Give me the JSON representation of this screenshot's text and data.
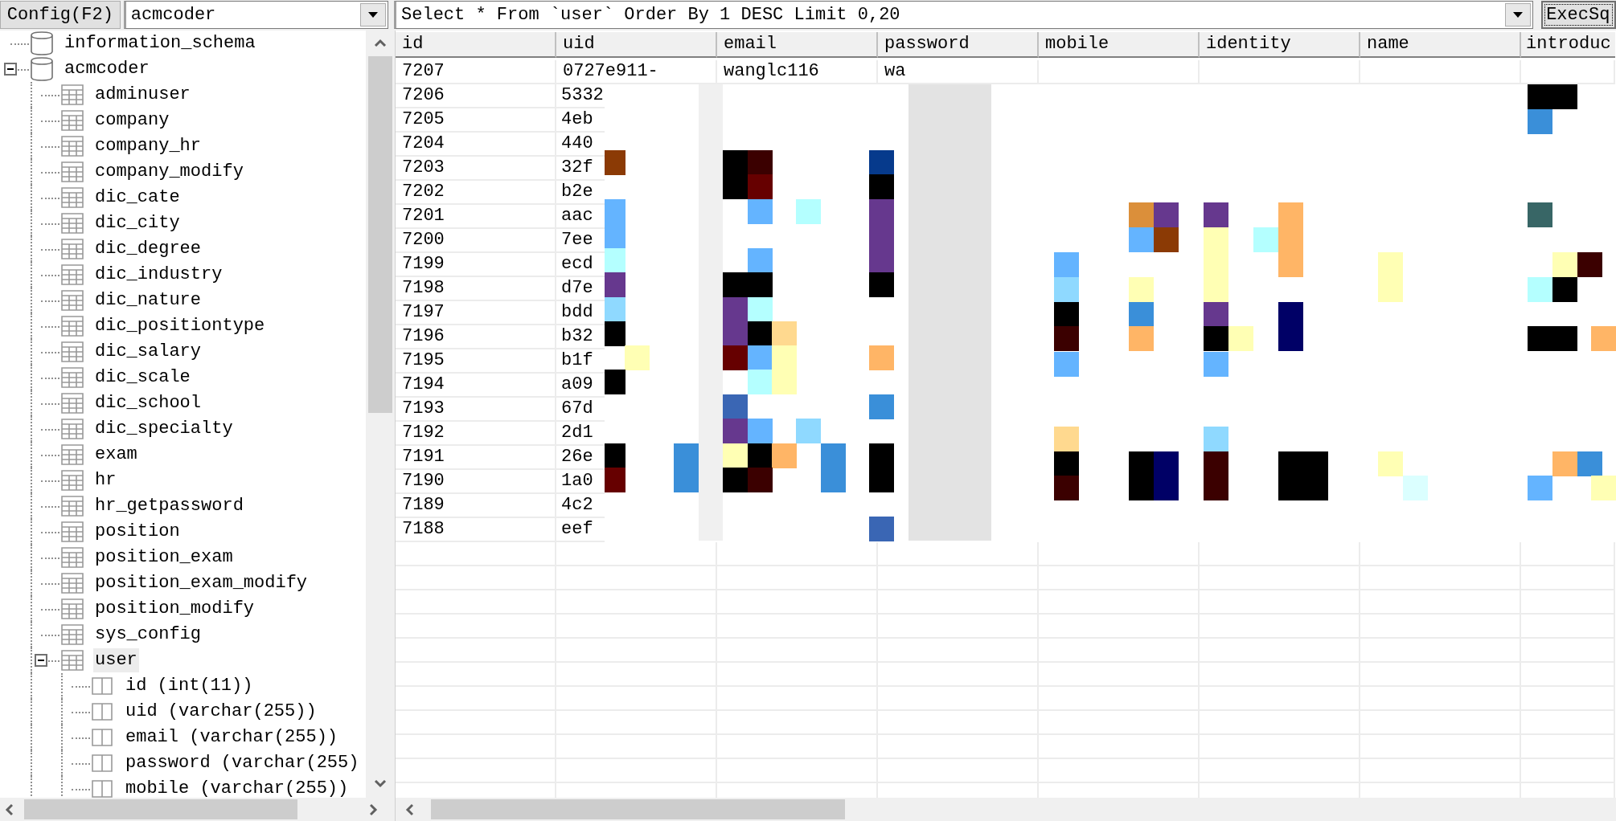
{
  "toolbar": {
    "config_button": "Config(F2)",
    "database_combo": {
      "value": "acmcoder"
    },
    "query_combo": {
      "value": "Select * From `user` Order By 1 DESC Limit 0,20"
    },
    "exec_button": "ExecSq"
  },
  "tree": [
    {
      "kind": "database",
      "label": "information_schema",
      "selected": false
    },
    {
      "kind": "database",
      "label": "acmcoder",
      "selected": false,
      "expanded": true,
      "children": [
        {
          "kind": "table",
          "label": "adminuser",
          "selected": false
        },
        {
          "kind": "table",
          "label": "company",
          "selected": false
        },
        {
          "kind": "table",
          "label": "company_hr",
          "selected": false
        },
        {
          "kind": "table",
          "label": "company_modify",
          "selected": false
        },
        {
          "kind": "table",
          "label": "dic_cate",
          "selected": false
        },
        {
          "kind": "table",
          "label": "dic_city",
          "selected": false
        },
        {
          "kind": "table",
          "label": "dic_degree",
          "selected": false
        },
        {
          "kind": "table",
          "label": "dic_industry",
          "selected": false
        },
        {
          "kind": "table",
          "label": "dic_nature",
          "selected": false
        },
        {
          "kind": "table",
          "label": "dic_positiontype",
          "selected": false
        },
        {
          "kind": "table",
          "label": "dic_salary",
          "selected": false
        },
        {
          "kind": "table",
          "label": "dic_scale",
          "selected": false
        },
        {
          "kind": "table",
          "label": "dic_school",
          "selected": false
        },
        {
          "kind": "table",
          "label": "dic_specialty",
          "selected": false
        },
        {
          "kind": "table",
          "label": "exam",
          "selected": false
        },
        {
          "kind": "table",
          "label": "hr",
          "selected": false
        },
        {
          "kind": "table",
          "label": "hr_getpassword",
          "selected": false
        },
        {
          "kind": "table",
          "label": "position",
          "selected": false
        },
        {
          "kind": "table",
          "label": "position_exam",
          "selected": false
        },
        {
          "kind": "table",
          "label": "position_exam_modify",
          "selected": false
        },
        {
          "kind": "table",
          "label": "position_modify",
          "selected": false
        },
        {
          "kind": "table",
          "label": "sys_config",
          "selected": false
        },
        {
          "kind": "table",
          "label": "user",
          "selected": true,
          "expanded": true,
          "children": [
            {
              "kind": "column",
              "label": "id (int(11))",
              "selected": false
            },
            {
              "kind": "column",
              "label": "uid (varchar(255))",
              "selected": false
            },
            {
              "kind": "column",
              "label": "email (varchar(255))",
              "selected": false
            },
            {
              "kind": "column",
              "label": "password (varchar(255)",
              "selected": false
            },
            {
              "kind": "column",
              "label": "mobile (varchar(255))",
              "selected": false
            }
          ]
        }
      ]
    }
  ],
  "grid": {
    "columns": [
      "id",
      "uid",
      "email",
      "password",
      "mobile",
      "identity",
      "name",
      "introduc"
    ],
    "rows": [
      [
        "7207",
        "0727e911-",
        "wanglc116",
        "wa"
      ],
      [
        "7206",
        "5332"
      ],
      [
        "7205",
        "4eb"
      ],
      [
        "7204",
        "440"
      ],
      [
        "7203",
        "32f"
      ],
      [
        "7202",
        "b2e"
      ],
      [
        "7201",
        "aac"
      ],
      [
        "7200",
        "7ee"
      ],
      [
        "7199",
        "ecd"
      ],
      [
        "7198",
        "d7e"
      ],
      [
        "7197",
        "bdd"
      ],
      [
        "7196",
        "b32"
      ],
      [
        "7195",
        "b1f"
      ],
      [
        "7194",
        "a09"
      ],
      [
        "7193",
        "67d"
      ],
      [
        "7192",
        "2d1"
      ],
      [
        "7191",
        "26e"
      ],
      [
        "7190",
        "1a0"
      ],
      [
        "7189",
        "4c2"
      ],
      [
        "7188",
        "eef"
      ]
    ]
  }
}
